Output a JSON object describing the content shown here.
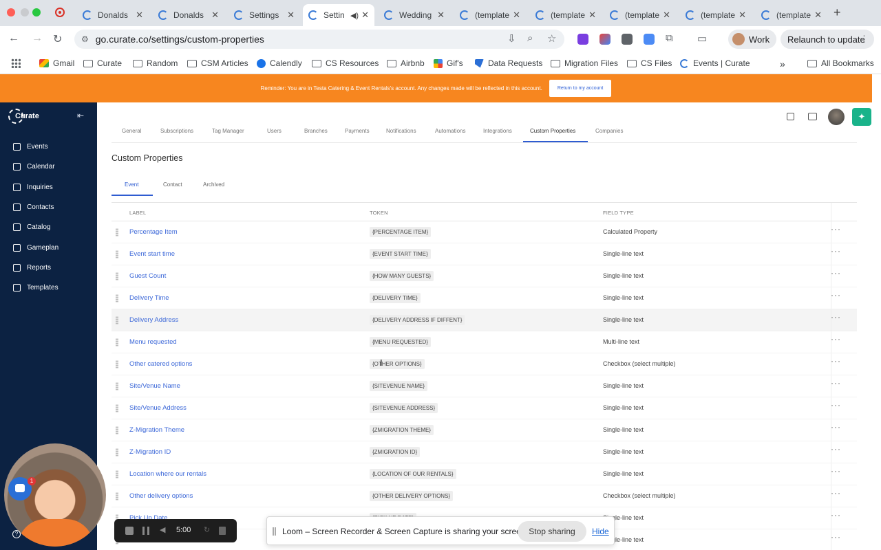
{
  "browser": {
    "tabs": [
      {
        "title": "Donalds",
        "active": false
      },
      {
        "title": "Donalds",
        "active": false
      },
      {
        "title": "Settings",
        "active": false
      },
      {
        "title": "Settin",
        "active": true
      },
      {
        "title": "Wedding",
        "active": false
      },
      {
        "title": "(template",
        "active": false
      },
      {
        "title": "(template",
        "active": false
      },
      {
        "title": "(template",
        "active": false
      },
      {
        "title": "(template",
        "active": false
      },
      {
        "title": "(template",
        "active": false
      }
    ],
    "url": "go.curate.co/settings/custom-properties",
    "profile_label": "Work",
    "relaunch_label": "Relaunch to update",
    "extension_badge": "9+",
    "bookmarks": [
      {
        "label": "Gmail",
        "icon": "gmail-icon"
      },
      {
        "label": "Curate",
        "icon": "folder-icon"
      },
      {
        "label": "Random",
        "icon": "folder-icon"
      },
      {
        "label": "CSM Articles",
        "icon": "folder-icon"
      },
      {
        "label": "Calendly",
        "icon": "calendly-icon"
      },
      {
        "label": "CS Resources",
        "icon": "folder-icon"
      },
      {
        "label": "Airbnb",
        "icon": "folder-icon"
      },
      {
        "label": "Gif's",
        "icon": "grid-icon"
      },
      {
        "label": "Data Requests",
        "icon": "drive-icon"
      },
      {
        "label": "Migration Files",
        "icon": "folder-icon"
      },
      {
        "label": "CS Files",
        "icon": "folder-icon"
      },
      {
        "label": "Events | Curate",
        "icon": "curate-icon"
      }
    ],
    "all_bookmarks_label": "All Bookmarks"
  },
  "reminder": {
    "message": "Reminder: You are in Testa Catering & Event Rentals's account. Any changes made will be reflected in this account.",
    "return_label": "Return to my account"
  },
  "sidebar": {
    "logo_text": "Curate",
    "items": [
      {
        "label": "Events",
        "icon": "events-icon"
      },
      {
        "label": "Calendar",
        "icon": "calendar-icon"
      },
      {
        "label": "Inquiries",
        "icon": "inquiries-icon"
      },
      {
        "label": "Contacts",
        "icon": "contacts-icon"
      },
      {
        "label": "Catalog",
        "icon": "catalog-icon"
      },
      {
        "label": "Gameplan",
        "icon": "gameplan-icon"
      },
      {
        "label": "Reports",
        "icon": "reports-icon"
      },
      {
        "label": "Templates",
        "icon": "templates-icon"
      }
    ]
  },
  "settings_tabs": [
    "General",
    "Subscriptions",
    "Tag Manager",
    "Users",
    "Branches",
    "Payments",
    "Notifications",
    "Automations",
    "Integrations",
    "Custom Properties",
    "Companies"
  ],
  "active_settings_tab": "Custom Properties",
  "page_title": "Custom Properties",
  "sub_tabs": [
    "Event",
    "Contact",
    "Archived"
  ],
  "active_sub_tab": "Event",
  "table": {
    "headers": {
      "label": "LABEL",
      "token": "TOKEN",
      "field_type": "FIELD TYPE"
    },
    "rows": [
      {
        "label": "Percentage Item",
        "token": "{PERCENTAGE ITEM}",
        "field_type": "Calculated Property"
      },
      {
        "label": "Event start time",
        "token": "{EVENT START TIME}",
        "field_type": "Single-line text"
      },
      {
        "label": "Guest Count",
        "token": "{HOW MANY GUESTS}",
        "field_type": "Single-line text"
      },
      {
        "label": "Delivery Time",
        "token": "{DELIVERY TIME}",
        "field_type": "Single-line text"
      },
      {
        "label": "Delivery Address",
        "token": "{DELIVERY ADDRESS IF DIFFENT}",
        "field_type": "Single-line text"
      },
      {
        "label": "Menu requested",
        "token": "{MENU REQUESTED}",
        "field_type": "Multi-line text"
      },
      {
        "label": "Other catered options",
        "token": "{OTHER OPTIONS}",
        "field_type": "Checkbox (select multiple)"
      },
      {
        "label": "Site/Venue Name",
        "token": "{SITEVENUE NAME}",
        "field_type": "Single-line text"
      },
      {
        "label": "Site/Venue Address",
        "token": "{SITEVENUE ADDRESS}",
        "field_type": "Single-line text"
      },
      {
        "label": "Z-Migration Theme",
        "token": "{ZMIGRATION THEME}",
        "field_type": "Single-line text"
      },
      {
        "label": "Z-Migration ID",
        "token": "{ZMIGRATION ID}",
        "field_type": "Single-line text"
      },
      {
        "label": "Location where our rentals",
        "token": "{LOCATION OF OUR RENTALS}",
        "field_type": "Single-line text"
      },
      {
        "label": "Other delivery options",
        "token": "{OTHER DELIVERY OPTIONS}",
        "field_type": "Checkbox (select multiple)"
      },
      {
        "label": "Pick Up Date",
        "token": "{PICK UP DATE}",
        "field_type": "Single-line text"
      },
      {
        "label": "",
        "token": "",
        "field_type": "Single-line text"
      }
    ]
  },
  "overlays": {
    "chat_badge": "1",
    "loom_time": "5:00",
    "share_message": "Loom – Screen Recorder & Screen Capture is sharing your screen.",
    "stop_sharing_label": "Stop sharing",
    "hide_label": "Hide"
  },
  "colors": {
    "reminder_bg": "#f7861f",
    "sidebar_bg": "#0c2242",
    "accent": "#2e5cd1",
    "ai_button": "#19b38a"
  }
}
